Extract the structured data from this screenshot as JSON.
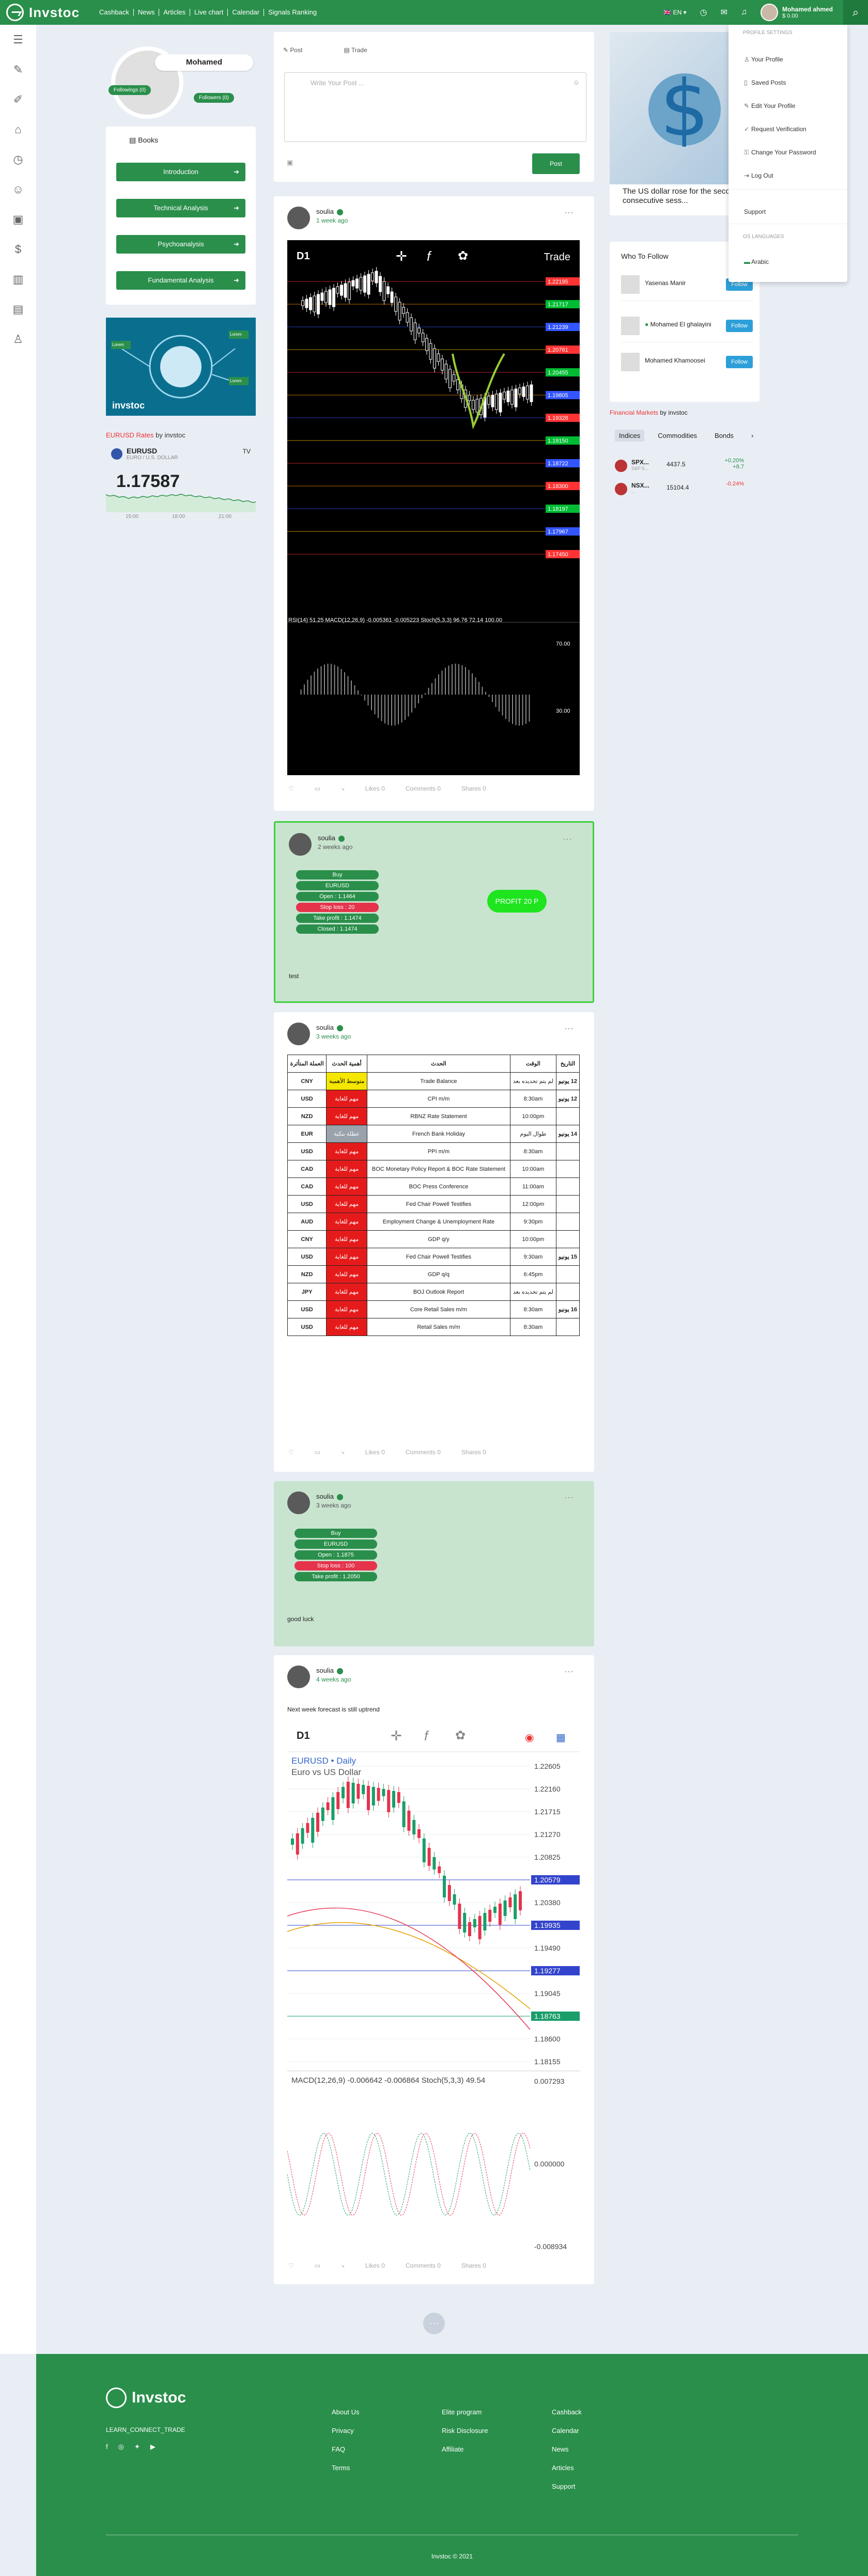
{
  "nav": {
    "brand": "Invstoc",
    "items": [
      "Cashback",
      "News",
      "Articles",
      "Live chart",
      "Calendar",
      "Signals Ranking"
    ],
    "lang": "EN",
    "user_name": "Mohamed ahmed",
    "user_balance": "$ 0.00"
  },
  "sidebar": [
    "menu-icon",
    "edit-icon",
    "pen-icon",
    "bank-icon",
    "clock-icon",
    "users-icon",
    "briefcase-icon",
    "dollar-icon",
    "building-icon",
    "book-icon",
    "user-icon"
  ],
  "profile": {
    "name": "Mohamed",
    "followings": "Followings (0)",
    "followers": "Followers (0)"
  },
  "books": {
    "title": "Books",
    "items": [
      "Introduction",
      "Technical Analysis",
      "Psychoanalysis",
      "Fundamental Analysis"
    ]
  },
  "ad": {
    "brand": "invstoc",
    "tags": [
      "Lorem",
      "Lorem",
      "Lorem"
    ]
  },
  "fx_widget": {
    "pre": "EURUSD",
    "rate": " Rates",
    "by": " by invstoc",
    "pair": "EURUSD",
    "pair_sub": "EURO / U.S. DOLLAR",
    "price": "1.17587",
    "ticks": [
      "15:00",
      "18:00",
      "21:00"
    ]
  },
  "composer": {
    "tab_post": "Post",
    "tab_trade": "Trade",
    "placeholder": "Write Your Post ...",
    "post_btn": "Post"
  },
  "posts": [
    {
      "user": "soulia",
      "time": "1 week ago",
      "likes": "Likes 0",
      "comments": "Comments 0",
      "shares": "Shares 0"
    },
    {
      "user": "soulia",
      "time": "2 weeks ago",
      "text": "test",
      "signals": [
        "Buy",
        "EURUSD",
        "Open : 1.1464",
        "Stop loss : 20",
        "Take profit : 1.1474",
        "Closed : 1.1474"
      ],
      "profit": "PROFIT 20 P"
    },
    {
      "user": "soulia",
      "time": "3 weeks ago",
      "likes": "Likes 0",
      "comments": "Comments 0",
      "shares": "Shares 0"
    },
    {
      "user": "soulia",
      "time": "3 weeks ago",
      "text": "good luck",
      "signals": [
        "Buy",
        "EURUSD",
        "Open : 1.1875",
        "Stop loss : 100",
        "Take profit : 1.2050"
      ]
    },
    {
      "user": "soulia",
      "time": "4 weeks ago",
      "text": "Next week forecast is still uptrend",
      "likes": "Likes 0",
      "comments": "Comments 0",
      "shares": "Shares 0"
    }
  ],
  "chart1": {
    "tf": "D1",
    "trade": "Trade",
    "indicators": "RSI(14) 51.25 MACD(12,26,9) -0.005361 -0.005223 Stoch(5,3,3) 96.76 72.14 100.00",
    "levels": [
      "1.22195",
      "1.21717",
      "1.21239",
      "1.20761",
      "1.20455",
      "1.19805",
      "1.19328",
      "1.19150",
      "1.18722",
      "1.18300",
      "1.18197",
      "1.17967",
      "1.17450"
    ],
    "osc": [
      "70.00",
      "30.00",
      "0.00"
    ]
  },
  "chart2": {
    "tf": "D1",
    "title": "EURUSD",
    "sub": " • Daily",
    "desc": "Euro vs US Dollar",
    "levels": [
      "1.22605",
      "1.22160",
      "1.21715",
      "1.21270",
      "1.20825",
      "1.20579",
      "1.20380",
      "1.19935",
      "1.19490",
      "1.19277",
      "1.19045",
      "1.18763",
      "1.18600",
      "1.18155"
    ],
    "macd": "MACD(12,26,9) -0.006642 -0.006864 Stoch(5,3,3) 49.54",
    "mvals": [
      "0.007293",
      "0.000000",
      "-0.008934"
    ]
  },
  "calendar": {
    "headers": [
      "التاريخ",
      "الوقت",
      "الحدث",
      "أهمية الحدث",
      "العملة المتأثرة"
    ],
    "rows": [
      [
        "12 يونيو",
        "لم يتم تحديده بعد",
        "Trade Balance",
        "متوسط الأهمية",
        "CNY"
      ],
      [
        "12 يونيو",
        "8:30am",
        "CPI m/m",
        "مهم للغاية",
        "USD"
      ],
      [
        "",
        "10:00pm",
        "RBNZ Rate Statement",
        "مهم للغاية",
        "NZD"
      ],
      [
        "14 يونيو",
        "طوال اليوم",
        "French Bank Holiday",
        "عطلة بنكية",
        "EUR"
      ],
      [
        "",
        "8:30am",
        "PPI m/m",
        "مهم للغاية",
        "USD"
      ],
      [
        "",
        "10:00am",
        "BOC Monetary Policy Report & BOC Rate Statement",
        "مهم للغاية",
        "CAD"
      ],
      [
        "",
        "11:00am",
        "BOC Press Conference",
        "مهم للغاية",
        "CAD"
      ],
      [
        "",
        "12:00pm",
        "Fed Chair Powell Testifies",
        "مهم للغاية",
        "USD"
      ],
      [
        "",
        "9:30pm",
        "Employment Change & Unemployment Rate",
        "مهم للغاية",
        "AUD"
      ],
      [
        "",
        "10:00pm",
        "GDP q/y",
        "مهم للغاية",
        "CNY"
      ],
      [
        "15 يونيو",
        "9:30am",
        "Fed Chair Powell Testifies",
        "مهم للغاية",
        "USD"
      ],
      [
        "",
        "6:45pm",
        "GDP q/q",
        "مهم للغاية",
        "NZD"
      ],
      [
        "",
        "لم يتم تحديده بعد",
        "BOJ Outlook Report",
        "مهم للغاية",
        "JPY"
      ],
      [
        "16 يونيو",
        "8:30am",
        "Core Retail Sales m/m",
        "مهم للغاية",
        "USD"
      ],
      [
        "",
        "8:30am",
        "Retail Sales m/m",
        "مهم للغاية",
        "USD"
      ]
    ]
  },
  "banner": {
    "text": "The US dollar rose for the second consecutive sess..."
  },
  "who_to_follow": {
    "title": "Who To Follow",
    "users": [
      "Yasenas Manir",
      "Mohamed El ghalayini",
      "Mohamed Khamoosei"
    ],
    "btn": "Follow"
  },
  "markets": {
    "pre": "Financial Markets",
    "by": " by invstoc",
    "tabs": [
      "Indices",
      "Commodities",
      "Bonds"
    ],
    "rows": [
      {
        "name": "SPX...",
        "sub": "S&P 5...",
        "val": "4437.5",
        "ch1": "+0.20%",
        "ch2": "+8.7"
      },
      {
        "name": "NSX...",
        "sub": "...",
        "val": "15104.4",
        "ch1": "-0.24%",
        "ch2": ""
      }
    ]
  },
  "dropdown": {
    "section1": "PROFILE SETTINGS",
    "items": [
      "Your Profile",
      "Saved Posts",
      "Edit Your Profile",
      "Request Verification",
      "Change Your Password",
      "Log Out"
    ],
    "support": "Support",
    "section2": "OS LANGUAGES",
    "lang": "Arabic"
  },
  "footer": {
    "brand": "Invstoc",
    "tag": "LEARN_CONNECT_TRADE",
    "col1": [
      "About Us",
      "Privacy",
      "FAQ",
      "Terms"
    ],
    "col2": [
      "Elite program",
      "Risk Disclosure",
      "Affiliate"
    ],
    "col3": [
      "Cashback",
      "Calendar",
      "News",
      "Articles",
      "Support"
    ],
    "copy": "Invstoc © 2021"
  }
}
